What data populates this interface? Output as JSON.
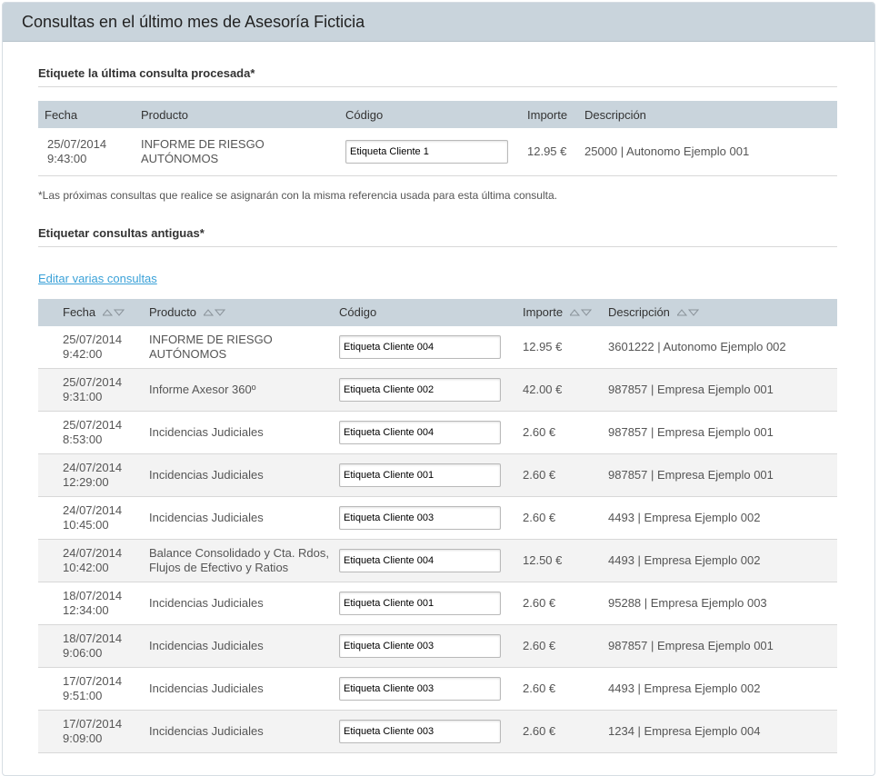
{
  "header": {
    "title": "Consultas en el último mes de Asesoría Ficticia"
  },
  "last_query": {
    "section_title": "Etiquete la última consulta procesada*",
    "columns": [
      "Fecha",
      "Producto",
      "Código",
      "Importe",
      "Descripción"
    ],
    "row": {
      "date": "25/07/2014",
      "time": "9:43:00",
      "product": "INFORME DE RIESGO AUTÓNOMOS",
      "code": "Etiqueta Cliente 1",
      "amount": "12.95 €",
      "description": "25000 | Autonomo Ejemplo 001"
    },
    "note": "*Las próximas consultas que realice se asignarán con la misma referencia usada para esta última consulta."
  },
  "old_queries": {
    "section_title": "Etiquetar consultas antiguas*",
    "edit_link": "Editar varias consultas",
    "columns": [
      "Fecha",
      "Producto",
      "Código",
      "Importe",
      "Descripción"
    ],
    "rows": [
      {
        "date": "25/07/2014",
        "time": "9:42:00",
        "product": "INFORME DE RIESGO AUTÓNOMOS",
        "code": "Etiqueta Cliente 004",
        "amount": "12.95 €",
        "description": "3601222 | Autonomo Ejemplo 002"
      },
      {
        "date": "25/07/2014",
        "time": "9:31:00",
        "product": "Informe Axesor 360º",
        "code": "Etiqueta Cliente 002",
        "amount": "42.00 €",
        "description": "987857 | Empresa Ejemplo 001"
      },
      {
        "date": "25/07/2014",
        "time": "8:53:00",
        "product": "Incidencias Judiciales",
        "code": "Etiqueta Cliente 004",
        "amount": "2.60 €",
        "description": "987857 | Empresa Ejemplo 001"
      },
      {
        "date": "24/07/2014",
        "time": "12:29:00",
        "product": "Incidencias Judiciales",
        "code": "Etiqueta Cliente 001",
        "amount": "2.60 €",
        "description": "987857 | Empresa Ejemplo 001"
      },
      {
        "date": "24/07/2014",
        "time": "10:45:00",
        "product": "Incidencias Judiciales",
        "code": "Etiqueta Cliente 003",
        "amount": "2.60 €",
        "description": "4493 | Empresa Ejemplo 002"
      },
      {
        "date": "24/07/2014",
        "time": "10:42:00",
        "product": "Balance Consolidado y Cta. Rdos, Flujos de Efectivo y Ratios",
        "code": "Etiqueta Cliente 004",
        "amount": "12.50 €",
        "description": "4493 | Empresa Ejemplo 002"
      },
      {
        "date": "18/07/2014",
        "time": "12:34:00",
        "product": "Incidencias Judiciales",
        "code": "Etiqueta Cliente 001",
        "amount": "2.60 €",
        "description": "95288 | Empresa Ejemplo 003"
      },
      {
        "date": "18/07/2014",
        "time": "9:06:00",
        "product": "Incidencias Judiciales",
        "code": "Etiqueta Cliente 003",
        "amount": "2.60 €",
        "description": "987857 | Empresa Ejemplo 001"
      },
      {
        "date": "17/07/2014",
        "time": "9:51:00",
        "product": "Incidencias Judiciales",
        "code": "Etiqueta Cliente 003",
        "amount": "2.60 €",
        "description": "4493 | Empresa Ejemplo 002"
      },
      {
        "date": "17/07/2014",
        "time": "9:09:00",
        "product": "Incidencias Judiciales",
        "code": "Etiqueta Cliente 003",
        "amount": "2.60 €",
        "description": "1234 | Empresa Ejemplo 004"
      }
    ]
  }
}
